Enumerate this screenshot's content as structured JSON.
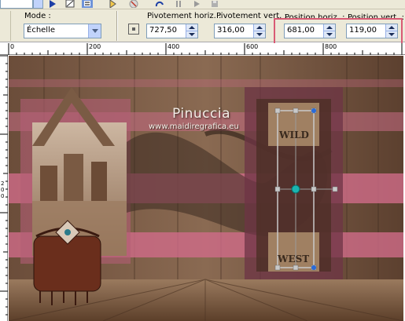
{
  "toolbar": {
    "icons": [
      "play-icon",
      "edit-icon",
      "list-icon",
      "select-icon",
      "stop-icon",
      "undo-icon",
      "pause-icon",
      "save-icon"
    ]
  },
  "options": {
    "mode_label": "Mode :",
    "mode_value": "Échelle",
    "pivot_h_label": "Pivotement horiz. :",
    "pivot_h_value": "727,50",
    "pivot_v_label": "Pivotement vert. :",
    "pivot_v_value": "316,00",
    "pos_h_label": "Position horiz. :",
    "pos_h_value": "681,00",
    "pos_v_label": "Position vert. :",
    "pos_v_value": "119,00",
    "highlight_color": "#d95a74"
  },
  "ruler": {
    "top_marks": [
      "0",
      "200",
      "400",
      "600",
      "800"
    ],
    "left_marks": [
      "2",
      "0",
      "0"
    ]
  },
  "canvas": {
    "watermark_title": "Pinuccia",
    "watermark_url": "www.maidiregrafica.eu",
    "sign_top": "WILD",
    "sign_bottom": "WEST",
    "accent_pink": "#c76b85",
    "wood_color": "#6b4d3a",
    "selection_handle_color": "#1ab5b0"
  }
}
